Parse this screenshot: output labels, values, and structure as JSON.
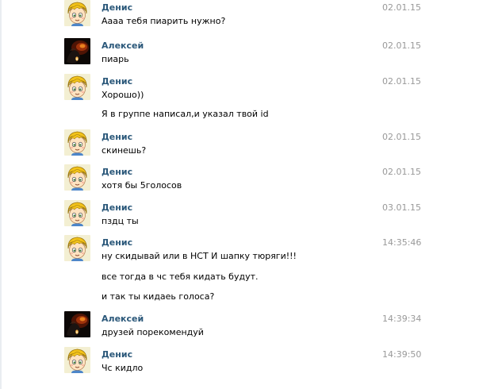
{
  "messages": [
    {
      "author": "Денис",
      "avatar": "denis",
      "date": "02.01.15",
      "lines": [
        "Аааа тебя пиарить нужно?"
      ]
    },
    {
      "author": "Алексей",
      "avatar": "aleksey",
      "date": "02.01.15",
      "lines": [
        "пиарь"
      ]
    },
    {
      "author": "Денис",
      "avatar": "denis",
      "date": "02.01.15",
      "lines": [
        "Хорошо))",
        "Я в группе написал,и указал твой id"
      ]
    },
    {
      "author": "Денис",
      "avatar": "denis",
      "date": "02.01.15",
      "lines": [
        "скинешь?"
      ]
    },
    {
      "author": "Денис",
      "avatar": "denis",
      "date": "02.01.15",
      "lines": [
        "хотя бы 5голосов"
      ]
    },
    {
      "author": "Денис",
      "avatar": "denis",
      "date": "03.01.15",
      "lines": [
        "пздц ты"
      ]
    },
    {
      "author": "Денис",
      "avatar": "denis",
      "date": "14:35:46",
      "lines": [
        "ну скидывай или в НСТ И шапку тюряги!!!",
        "все тогда в чс тебя кидать будут.",
        "и так ты кидаеь голоса?"
      ]
    },
    {
      "author": "Алексей",
      "avatar": "aleksey",
      "date": "14:39:34",
      "lines": [
        "друзей порекомендуй"
      ]
    },
    {
      "author": "Денис",
      "avatar": "denis",
      "date": "14:39:50",
      "lines": [
        "Чс кидло"
      ]
    }
  ],
  "colors": {
    "author": "#2b587a",
    "date": "#999999",
    "text": "#000000"
  },
  "icons": {
    "denis": "cartoon-boy-avatar-icon",
    "aleksey": "dark-fire-avatar-icon"
  }
}
